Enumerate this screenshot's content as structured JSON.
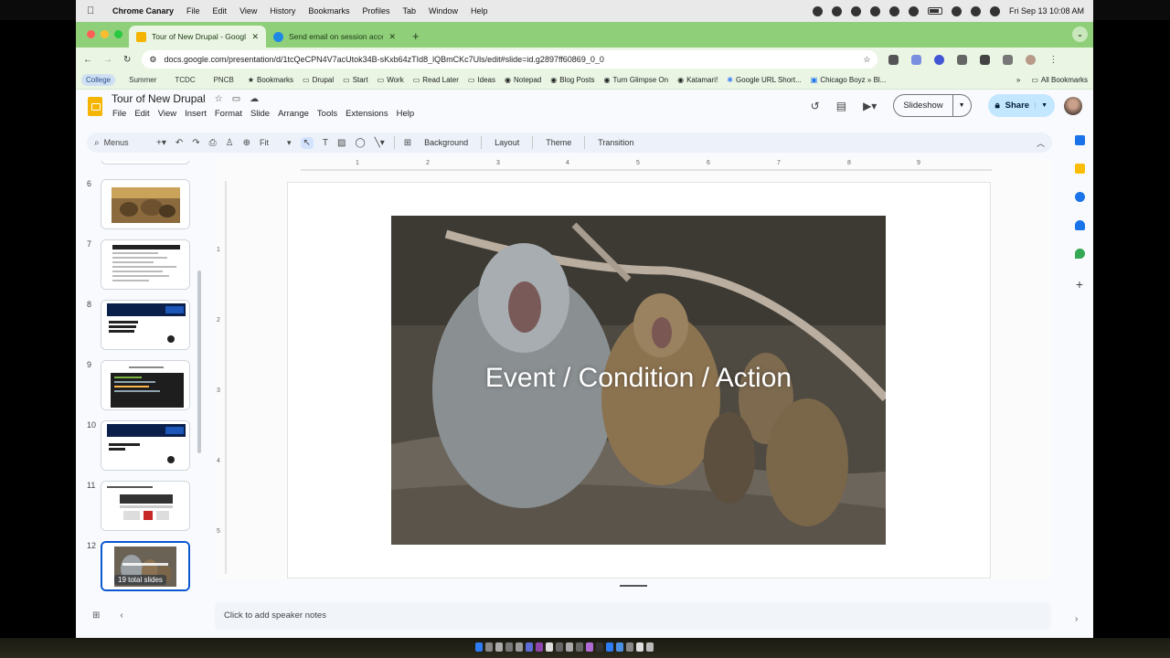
{
  "menubar": {
    "app_name": "Chrome Canary",
    "items": [
      "File",
      "Edit",
      "View",
      "History",
      "Bookmarks",
      "Profiles",
      "Tab",
      "Window",
      "Help"
    ],
    "datetime": "Fri Sep 13  10:08 AM"
  },
  "tabs": [
    {
      "title": "Tour of New Drupal - Google",
      "favicon_color": "#f4b400",
      "active": true
    },
    {
      "title": "Send email on session accep",
      "favicon_color": "#1e88e5",
      "active": false
    }
  ],
  "address_bar": {
    "url": "docs.google.com/presentation/d/1tcQeCPN4V7acUtok34B-sKxb64zTId8_lQBmCKc7Uls/edit#slide=id.g2897ff60869_0_0"
  },
  "bookmarks": {
    "pills": [
      "College",
      "Summer",
      "TCDC",
      "PNCB"
    ],
    "items": [
      "Bookmarks",
      "Drupal",
      "Start",
      "Work",
      "Read Later",
      "Ideas",
      "Notepad",
      "Blog Posts",
      "Turn Glimpse On",
      "Katamari!",
      "Google URL Short...",
      "Chicago Boyz » Bl..."
    ],
    "more": "»",
    "all_bookmarks": "All Bookmarks"
  },
  "doc": {
    "title": "Tour of New Drupal",
    "menu": [
      "File",
      "Edit",
      "View",
      "Insert",
      "Format",
      "Slide",
      "Arrange",
      "Tools",
      "Extensions",
      "Help"
    ],
    "slideshow_label": "Slideshow",
    "share_label": "Share"
  },
  "toolbar": {
    "search_label": "Menus",
    "zoom_label": "Fit",
    "background_label": "Background",
    "layout_label": "Layout",
    "theme_label": "Theme",
    "transition_label": "Transition"
  },
  "filmstrip": {
    "slide_numbers": [
      "6",
      "7",
      "8",
      "9",
      "10",
      "11",
      "12"
    ],
    "total_label": "19 total slides",
    "selected": "12"
  },
  "rulers": {
    "horizontal": [
      "1",
      "2",
      "3",
      "4",
      "5",
      "6",
      "7",
      "8",
      "9"
    ],
    "vertical": [
      "1",
      "2",
      "3",
      "4",
      "5"
    ]
  },
  "slide": {
    "text": "Event / Condition / Action"
  },
  "notes": {
    "placeholder": "Click to add speaker notes"
  },
  "colors": {
    "chrome_accent": "#8fcf7a",
    "share_button": "#c2e7ff",
    "selected_slide_border": "#0b57d0"
  }
}
